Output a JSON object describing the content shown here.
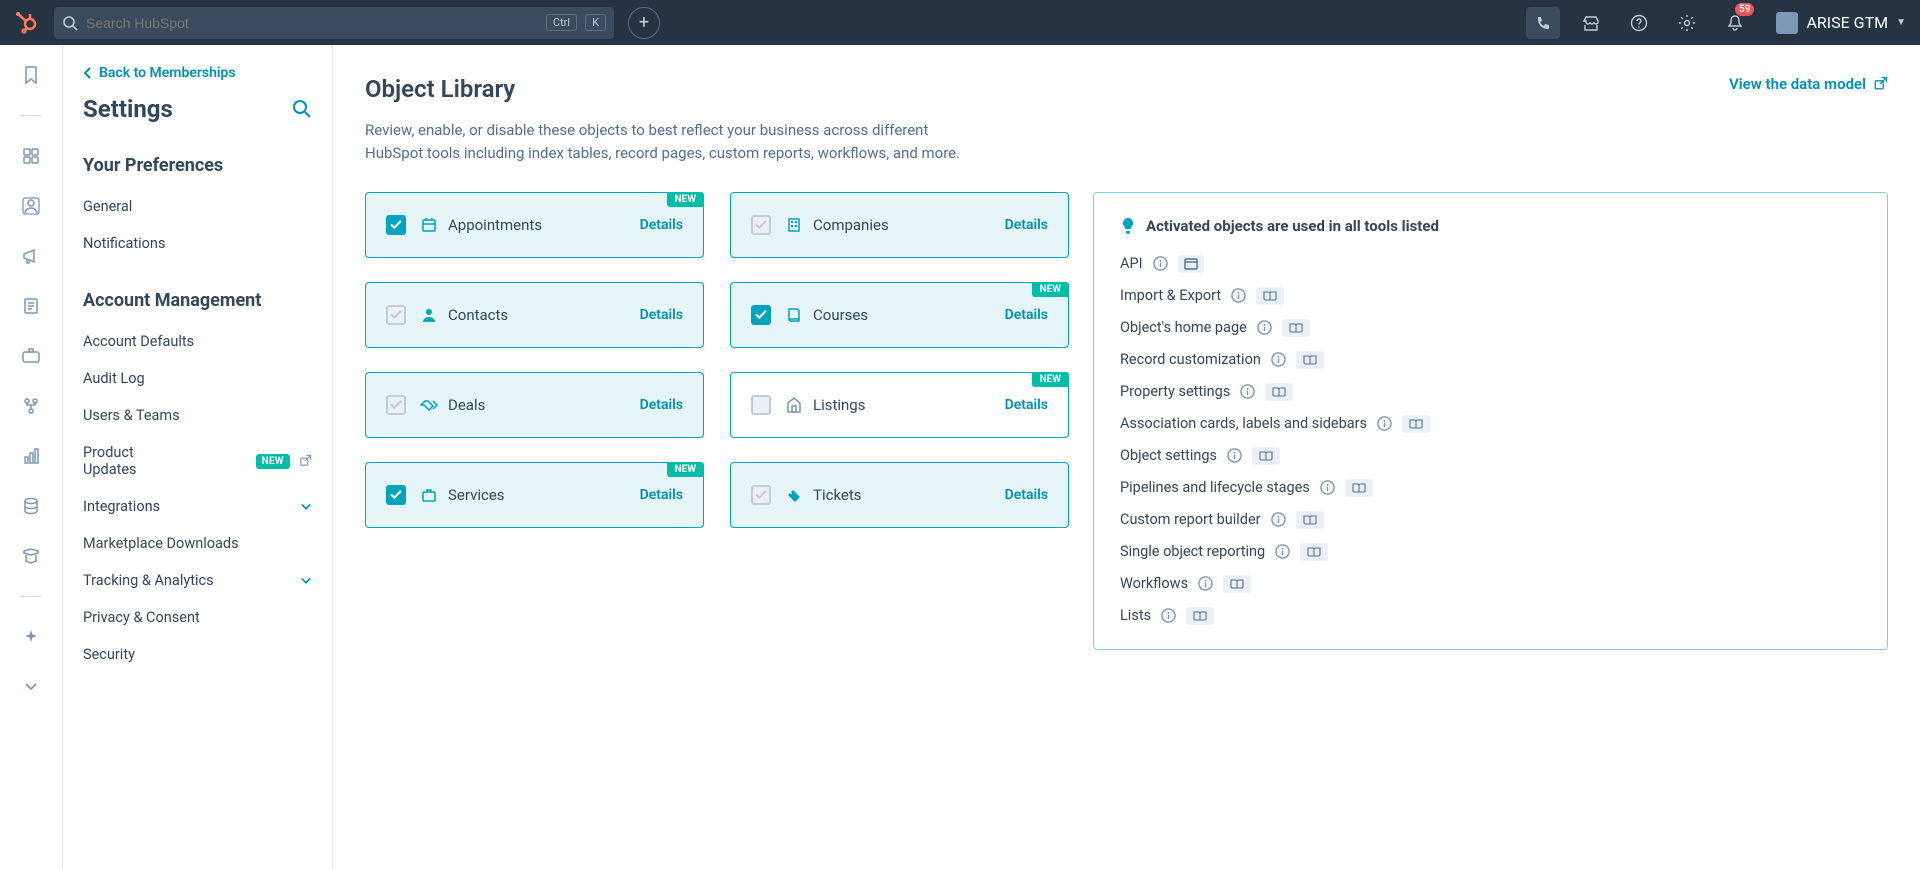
{
  "topnav": {
    "search_placeholder": "Search HubSpot",
    "shortcut1": "Ctrl",
    "shortcut2": "K",
    "badge_count": "59",
    "workspace_name": "ARISE GTM"
  },
  "sidebar": {
    "back_label": "Back to Memberships",
    "title": "Settings",
    "section_prefs": "Your Preferences",
    "prefs": {
      "general": "General",
      "notifications": "Notifications"
    },
    "section_account": "Account Management",
    "account": {
      "defaults": "Account Defaults",
      "audit": "Audit Log",
      "users": "Users & Teams",
      "product_updates": "Product Updates",
      "product_updates_badge": "NEW",
      "integrations": "Integrations",
      "marketplace": "Marketplace Downloads",
      "tracking": "Tracking & Analytics",
      "privacy": "Privacy & Consent",
      "security": "Security"
    }
  },
  "main": {
    "title": "Object Library",
    "data_model_link": "View the data model",
    "subtitle": "Review, enable, or disable these objects to best reflect your business across different HubSpot tools including index tables, record pages, custom reports, workflows, and more.",
    "details_label": "Details",
    "new_badge": "NEW",
    "cards": {
      "appointments": "Appointments",
      "companies": "Companies",
      "contacts": "Contacts",
      "courses": "Courses",
      "deals": "Deals",
      "listings": "Listings",
      "services": "Services",
      "tickets": "Tickets"
    }
  },
  "info": {
    "heading": "Activated objects are used in all tools listed",
    "items": {
      "api": "API",
      "import": "Import & Export",
      "home": "Object's home page",
      "record": "Record customization",
      "property": "Property settings",
      "assoc": "Association cards, labels and sidebars",
      "objsettings": "Object settings",
      "pipelines": "Pipelines and lifecycle stages",
      "reportbuilder": "Custom report builder",
      "singlereport": "Single object reporting",
      "workflows": "Workflows",
      "lists": "Lists"
    }
  }
}
